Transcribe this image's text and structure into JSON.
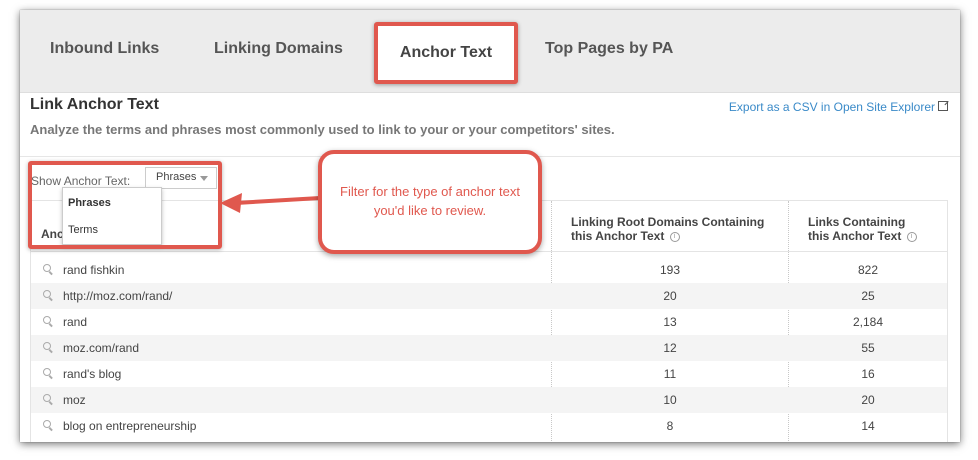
{
  "tabs": [
    {
      "label": "Inbound Links"
    },
    {
      "label": "Linking Domains"
    },
    {
      "label": "Anchor Text"
    },
    {
      "label": "Top Pages by PA"
    }
  ],
  "section": {
    "title": "Link Anchor Text",
    "subtitle": "Analyze the terms and phrases most commonly used to link to your or your competitors' sites.",
    "export_link": "Export as a CSV in Open Site Explorer"
  },
  "filter": {
    "label": "Show Anchor Text:",
    "selected": "Phrases",
    "options": [
      "Phrases",
      "Terms"
    ]
  },
  "callout": {
    "text": "Filter for the type of anchor text you'd like to review."
  },
  "table": {
    "headers": {
      "anchor": "Anc",
      "root_domains": "Linking Root Domains Containing this Anchor Text",
      "links": "Links Containing this Anchor Text"
    },
    "rows": [
      {
        "anchor": "rand fishkin",
        "root_domains": "193",
        "links": "822"
      },
      {
        "anchor": "http://moz.com/rand/",
        "root_domains": "20",
        "links": "25"
      },
      {
        "anchor": "rand",
        "root_domains": "13",
        "links": "2,184"
      },
      {
        "anchor": "moz.com/rand",
        "root_domains": "12",
        "links": "55"
      },
      {
        "anchor": "rand's blog",
        "root_domains": "11",
        "links": "16"
      },
      {
        "anchor": "moz",
        "root_domains": "10",
        "links": "20"
      },
      {
        "anchor": "blog on entrepreneurship",
        "root_domains": "8",
        "links": "14"
      }
    ]
  },
  "colors": {
    "highlight": "#e0584e",
    "link": "#3a8ac8"
  }
}
